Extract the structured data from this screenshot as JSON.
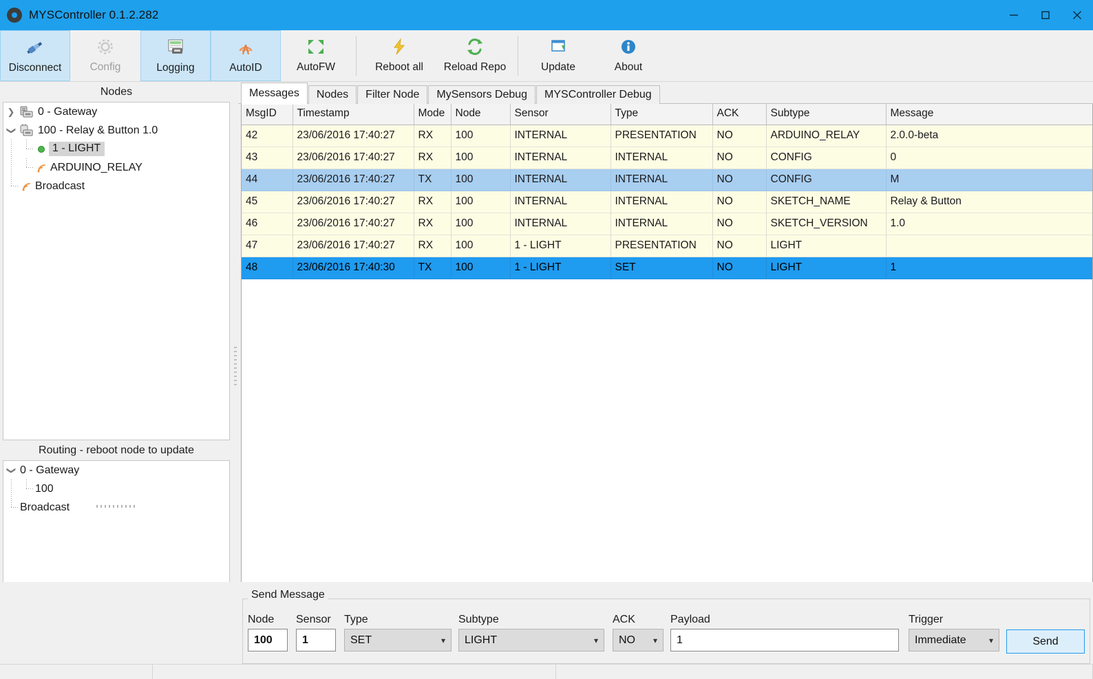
{
  "window": {
    "title": "MYSController 0.1.2.282",
    "icon": "gear-icon",
    "minimize": "—",
    "maximize": "□",
    "close": "✕",
    "titlebar_color": "#1fa0ec"
  },
  "toolbar": {
    "items": [
      {
        "label": "Disconnect",
        "icon": "plug-disconnect-icon",
        "state": "selected"
      },
      {
        "label": "Config",
        "icon": "gear-icon",
        "state": "disabled"
      },
      {
        "label": "Logging",
        "icon": "log-window-icon",
        "state": "selected"
      },
      {
        "label": "AutoID",
        "icon": "antenna-signal-icon",
        "state": "selected"
      },
      {
        "label": "AutoFW",
        "icon": "arrows-expand-icon",
        "state": "normal"
      },
      {
        "label": "Reboot all",
        "icon": "lightning-bolt-icon",
        "state": "normal"
      },
      {
        "label": "Reload Repo",
        "icon": "refresh-arrows-icon",
        "state": "normal"
      },
      {
        "label": "Update",
        "icon": "download-window-icon",
        "state": "normal"
      },
      {
        "label": "About",
        "icon": "info-circle-icon",
        "state": "normal"
      }
    ]
  },
  "nodes_panel": {
    "title": "Nodes",
    "tree": [
      {
        "label": "0 - Gateway",
        "depth": 0,
        "twisty": "collapsed",
        "icon": "gateway-icon",
        "selected": false
      },
      {
        "label": "100 - Relay & Button 1.0",
        "depth": 0,
        "twisty": "expanded",
        "icon": "node-icon",
        "selected": false
      },
      {
        "label": "1 - LIGHT",
        "depth": 1,
        "twisty": "none",
        "icon": "green-dot-icon",
        "selected": true
      },
      {
        "label": "ARDUINO_RELAY",
        "depth": 1,
        "twisty": "none",
        "icon": "signal-icon",
        "selected": false
      },
      {
        "label": "Broadcast",
        "depth": 0,
        "twisty": "none",
        "icon": "signal-icon",
        "selected": false
      }
    ]
  },
  "routing_panel": {
    "title": "Routing - reboot node to update",
    "tree": [
      {
        "label": "0 - Gateway",
        "depth": 0,
        "twisty": "expanded"
      },
      {
        "label": "100",
        "depth": 1,
        "twisty": "none"
      },
      {
        "label": "Broadcast",
        "depth": 0,
        "twisty": "none"
      }
    ]
  },
  "tabs": [
    {
      "label": "Messages",
      "active": true
    },
    {
      "label": "Nodes",
      "active": false
    },
    {
      "label": "Filter Node",
      "active": false
    },
    {
      "label": "MySensors Debug",
      "active": false
    },
    {
      "label": "MYSController Debug",
      "active": false
    }
  ],
  "message_table": {
    "columns": [
      "MsgID",
      "Timestamp",
      "Mode",
      "Node",
      "Sensor",
      "Type",
      "ACK",
      "Subtype",
      "Message"
    ],
    "rows": [
      {
        "style": "rx",
        "cells": [
          "42",
          "23/06/2016 17:40:27",
          "RX",
          "100",
          "INTERNAL",
          "PRESENTATION",
          "NO",
          "ARDUINO_RELAY",
          "2.0.0-beta"
        ]
      },
      {
        "style": "rx",
        "cells": [
          "43",
          "23/06/2016 17:40:27",
          "RX",
          "100",
          "INTERNAL",
          "INTERNAL",
          "NO",
          "CONFIG",
          "0"
        ]
      },
      {
        "style": "tx",
        "cells": [
          "44",
          "23/06/2016 17:40:27",
          "TX",
          "100",
          "INTERNAL",
          "INTERNAL",
          "NO",
          "CONFIG",
          "M"
        ]
      },
      {
        "style": "rx",
        "cells": [
          "45",
          "23/06/2016 17:40:27",
          "RX",
          "100",
          "INTERNAL",
          "INTERNAL",
          "NO",
          "SKETCH_NAME",
          "Relay & Button"
        ]
      },
      {
        "style": "rx",
        "cells": [
          "46",
          "23/06/2016 17:40:27",
          "RX",
          "100",
          "INTERNAL",
          "INTERNAL",
          "NO",
          "SKETCH_VERSION",
          "1.0"
        ]
      },
      {
        "style": "rx",
        "cells": [
          "47",
          "23/06/2016 17:40:27",
          "RX",
          "100",
          "1 - LIGHT",
          "PRESENTATION",
          "NO",
          "LIGHT",
          ""
        ]
      },
      {
        "style": "tx-sel",
        "cells": [
          "48",
          "23/06/2016 17:40:30",
          "TX",
          "100",
          "1 - LIGHT",
          "SET",
          "NO",
          "LIGHT",
          "1"
        ]
      }
    ],
    "row_colors": {
      "rx": "#fdfde4",
      "tx": "#a8cef0",
      "tx_selected": "#1f9bf0"
    }
  },
  "send_message": {
    "legend": "Send Message",
    "node": {
      "label": "Node",
      "value": "100"
    },
    "sensor": {
      "label": "Sensor",
      "value": "1"
    },
    "type": {
      "label": "Type",
      "value": "SET"
    },
    "subtype": {
      "label": "Subtype",
      "value": "LIGHT"
    },
    "ack": {
      "label": "ACK",
      "value": "NO"
    },
    "payload": {
      "label": "Payload",
      "value": "1"
    },
    "trigger": {
      "label": "Trigger",
      "value": "Immediate"
    },
    "send_button": "Send"
  }
}
